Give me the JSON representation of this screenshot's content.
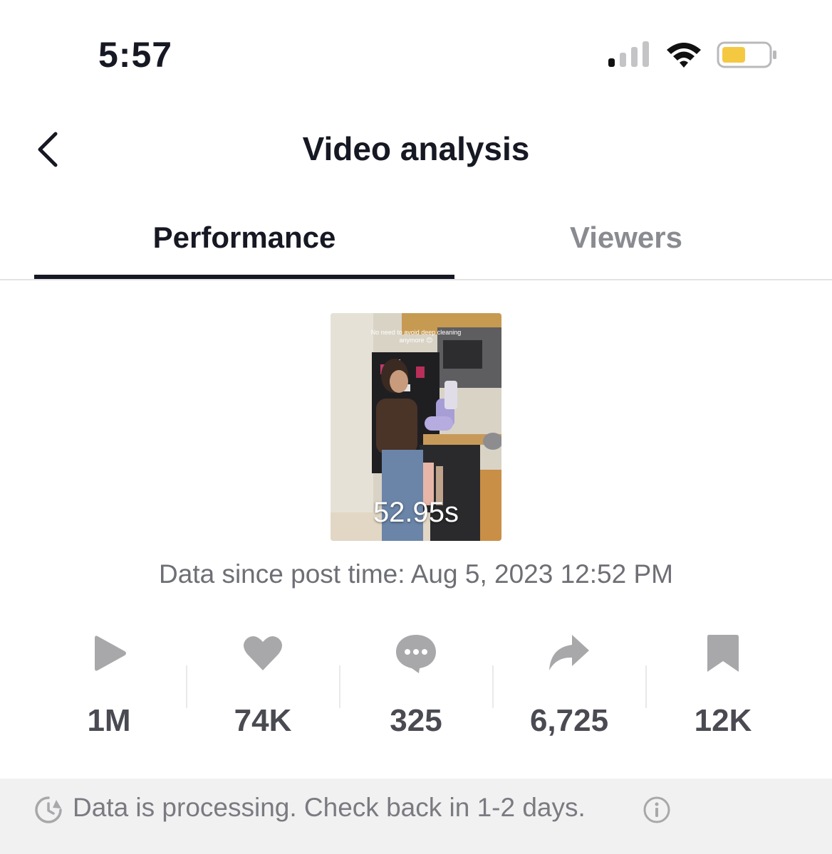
{
  "status_bar": {
    "time": "5:57"
  },
  "header": {
    "title": "Video analysis"
  },
  "tabs": [
    {
      "label": "Performance",
      "active": true
    },
    {
      "label": "Viewers",
      "active": false
    }
  ],
  "video": {
    "caption": "No need to avoid deep cleaning anymore 😊",
    "duration": "52.95s"
  },
  "post_time": "Data since post time: Aug 5, 2023 12:52 PM",
  "stats": [
    {
      "icon": "play-icon",
      "value": "1M"
    },
    {
      "icon": "heart-icon",
      "value": "74K"
    },
    {
      "icon": "comment-icon",
      "value": "325"
    },
    {
      "icon": "share-icon",
      "value": "6,725"
    },
    {
      "icon": "bookmark-icon",
      "value": "12K"
    }
  ],
  "footer": {
    "message": "Data is processing. Check back in 1-2 days."
  },
  "colors": {
    "text_primary": "#161823",
    "text_muted": "#8a8b91",
    "icon_gray": "#a8a8ab",
    "battery": "#f5c842"
  }
}
